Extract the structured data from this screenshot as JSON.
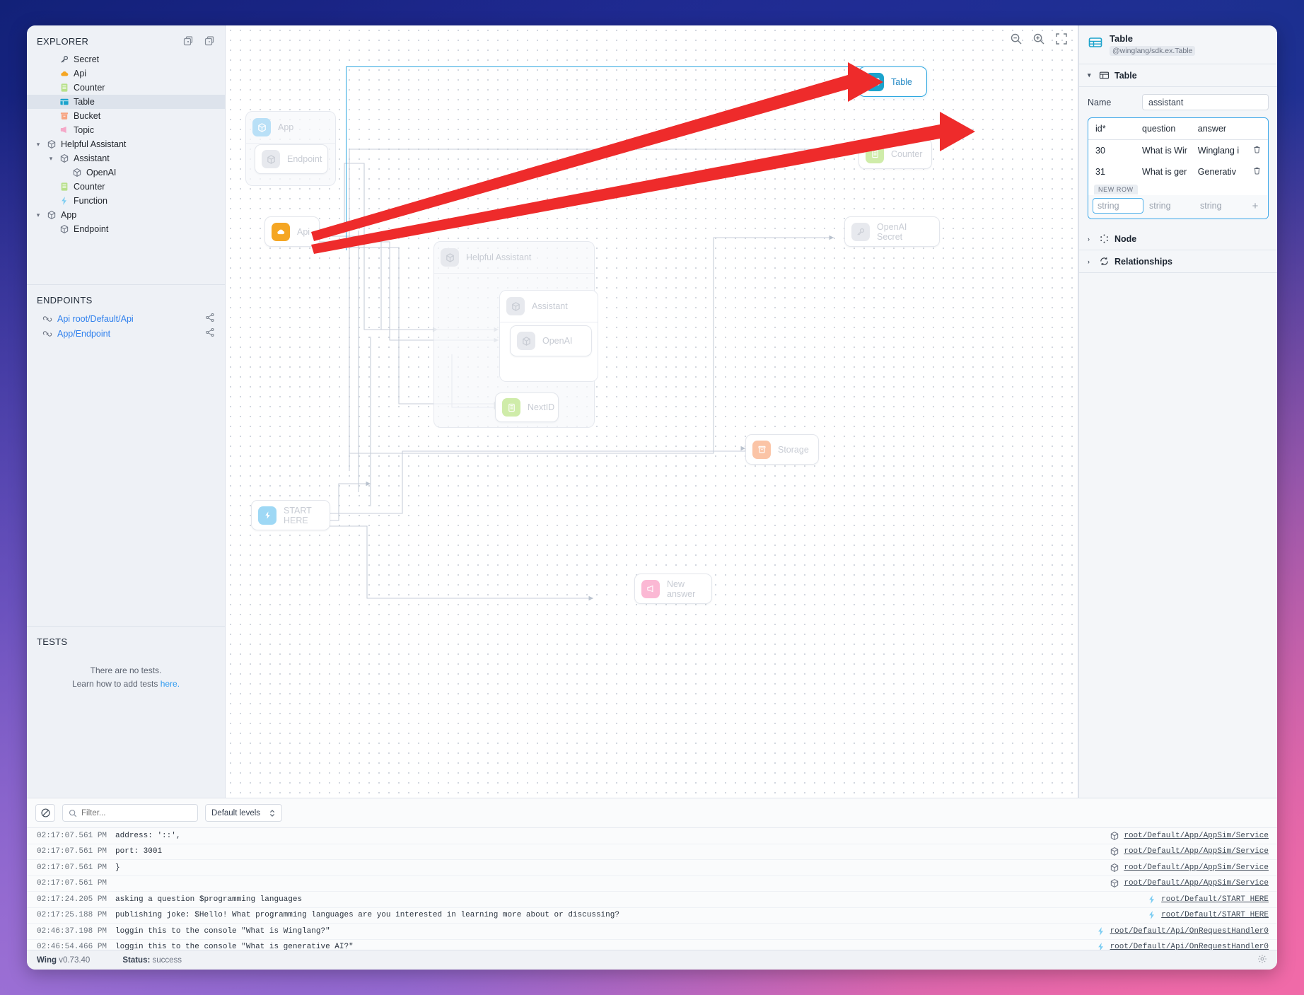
{
  "sidebar": {
    "explorer_title": "EXPLORER",
    "explorer_tools": [
      {
        "name": "expand-all-icon"
      },
      {
        "name": "collapse-all-icon"
      }
    ],
    "tree": [
      {
        "label": "Secret",
        "icon": "secret-key-icon",
        "indent": 1,
        "chev": "",
        "selected": false
      },
      {
        "label": "Api",
        "icon": "api-cloud-icon",
        "indent": 1,
        "chev": "",
        "selected": false
      },
      {
        "label": "Counter",
        "icon": "counter-icon",
        "indent": 1,
        "chev": "",
        "selected": false
      },
      {
        "label": "Table",
        "icon": "table-icon",
        "indent": 1,
        "chev": "",
        "selected": true
      },
      {
        "label": "Bucket",
        "icon": "bucket-icon",
        "indent": 1,
        "chev": "",
        "selected": false
      },
      {
        "label": "Topic",
        "icon": "topic-icon",
        "indent": 1,
        "chev": "",
        "selected": false
      },
      {
        "label": "Helpful Assistant",
        "icon": "cube-icon",
        "indent": 0,
        "chev": "v",
        "selected": false
      },
      {
        "label": "Assistant",
        "icon": "cube-icon",
        "indent": 1,
        "chev": "v",
        "selected": false
      },
      {
        "label": "OpenAI",
        "icon": "cube-icon",
        "indent": 2,
        "chev": "",
        "selected": false
      },
      {
        "label": "Counter",
        "icon": "counter-icon",
        "indent": 1,
        "chev": "",
        "selected": false
      },
      {
        "label": "Function",
        "icon": "function-bolt-icon",
        "indent": 1,
        "chev": "",
        "selected": false
      },
      {
        "label": "App",
        "icon": "cube-icon",
        "indent": 0,
        "chev": "v",
        "selected": false
      },
      {
        "label": "Endpoint",
        "icon": "cube-icon",
        "indent": 1,
        "chev": "",
        "selected": false
      }
    ],
    "endpoints_title": "ENDPOINTS",
    "endpoints": [
      {
        "label": "Api root/Default/Api",
        "icon": "link-icon",
        "action_icon": "share-icon"
      },
      {
        "label": "App/Endpoint",
        "icon": "link-icon",
        "action_icon": "share-icon"
      }
    ],
    "tests_title": "TESTS",
    "tests_empty_line1": "There are no tests.",
    "tests_empty_line2": "Learn how to add tests ",
    "tests_empty_link": "here."
  },
  "canvas": {
    "tools": [
      {
        "name": "zoom-out-icon"
      },
      {
        "name": "zoom-in-icon"
      },
      {
        "name": "fit-screen-icon"
      }
    ],
    "nodes": [
      {
        "id": "table",
        "label": "Table",
        "icon": "table-icon",
        "selected": true
      },
      {
        "id": "counter",
        "label": "Counter",
        "icon": "counter-icon",
        "selected": false
      },
      {
        "id": "openai-secret",
        "label": "OpenAI Secret",
        "icon": "secret-key-icon",
        "selected": false
      },
      {
        "id": "storage",
        "label": "Storage",
        "icon": "bucket-icon",
        "selected": false
      },
      {
        "id": "new-answer",
        "label": "New answer",
        "icon": "topic-icon",
        "selected": false
      },
      {
        "id": "start-here",
        "label": "START HERE",
        "icon": "function-bolt-icon",
        "selected": false
      },
      {
        "id": "api",
        "label": "Api",
        "icon": "api-cloud-icon",
        "selected": false
      },
      {
        "id": "nextid",
        "label": "NextID",
        "icon": "counter-icon",
        "selected": false
      },
      {
        "id": "openai",
        "label": "OpenAI",
        "icon": "cube-icon",
        "selected": false
      }
    ],
    "groups": [
      {
        "id": "app",
        "label": "App",
        "icon": "cube-icon"
      },
      {
        "id": "endpoint",
        "label": "Endpoint",
        "icon": "cube-icon"
      },
      {
        "id": "helpful-assistant",
        "label": "Helpful Assistant",
        "icon": "cube-icon"
      },
      {
        "id": "assistant",
        "label": "Assistant",
        "icon": "cube-icon"
      }
    ]
  },
  "inspector": {
    "title": "Table",
    "subtitle": "@winglang/sdk.ex.Table",
    "sections": [
      {
        "label": "Table",
        "icon": "table-icon",
        "expanded": true
      },
      {
        "label": "Node",
        "icon": "node-dots-icon",
        "expanded": false
      },
      {
        "label": "Relationships",
        "icon": "relationships-icon",
        "expanded": false
      }
    ],
    "name_label": "Name",
    "name_value": "assistant",
    "grid": {
      "columns": [
        "id*",
        "question",
        "answer"
      ],
      "rows": [
        {
          "id": "30",
          "question": "What is Wir",
          "answer": "Winglang i",
          "delete_icon": "trash-icon"
        },
        {
          "id": "31",
          "question": "What is ger",
          "answer": "Generativ",
          "delete_icon": "trash-icon"
        }
      ],
      "new_row_label": "NEW ROW",
      "new_row_placeholders": [
        "string",
        "string",
        "string"
      ],
      "add_icon": "plus-icon"
    }
  },
  "console": {
    "clear_icon": "clear-console-icon",
    "search_icon": "search-icon",
    "filter_placeholder": "Filter...",
    "filter_value": "",
    "levels_label": "Default levels",
    "levels_chevron": "chevron-updown-icon",
    "logs": [
      {
        "time": "02:17:07.561 PM",
        "message": "   address: '::',",
        "source": "root/Default/App/AppSim/Service",
        "source_icon": "cube-icon"
      },
      {
        "time": "02:17:07.561 PM",
        "message": "   port: 3001",
        "source": "root/Default/App/AppSim/Service",
        "source_icon": "cube-icon"
      },
      {
        "time": "02:17:07.561 PM",
        "message": "}",
        "source": "root/Default/App/AppSim/Service",
        "source_icon": "cube-icon"
      },
      {
        "time": "02:17:07.561 PM",
        "message": "",
        "source": "root/Default/App/AppSim/Service",
        "source_icon": "cube-icon"
      },
      {
        "time": "02:17:24.205 PM",
        "message": "asking a question $programming languages",
        "source": "root/Default/START HERE",
        "source_icon": "function-bolt-icon"
      },
      {
        "time": "02:17:25.188 PM",
        "message": "publishing joke: $Hello! What programming languages are you interested in learning more about or discussing?",
        "source": "root/Default/START HERE",
        "source_icon": "function-bolt-icon"
      },
      {
        "time": "02:46:37.198 PM",
        "message": "loggin this to the console \"What is Winglang?\"",
        "source": "root/Default/Api/OnRequestHandler0",
        "source_icon": "function-bolt-icon"
      },
      {
        "time": "02:46:54.466 PM",
        "message": "loggin this to the console \"What is generative AI?\"",
        "source": "root/Default/Api/OnRequestHandler0",
        "source_icon": "function-bolt-icon"
      }
    ]
  },
  "statusbar": {
    "app_name": "Wing",
    "version": "v0.73.40",
    "status_label": "Status:",
    "status_value": "success",
    "settings_icon": "gear-icon"
  },
  "colors": {
    "accent": "#2ea7e0",
    "link": "#2f80ed",
    "arrow": "#ee2b2b",
    "table_icon": "#1ba3cc",
    "api_icon": "#f5a623",
    "counter_icon": "#b7e08a",
    "bucket_icon": "#f7a583",
    "topic_icon": "#f5a8c8",
    "function_icon": "#7dcdf2"
  }
}
